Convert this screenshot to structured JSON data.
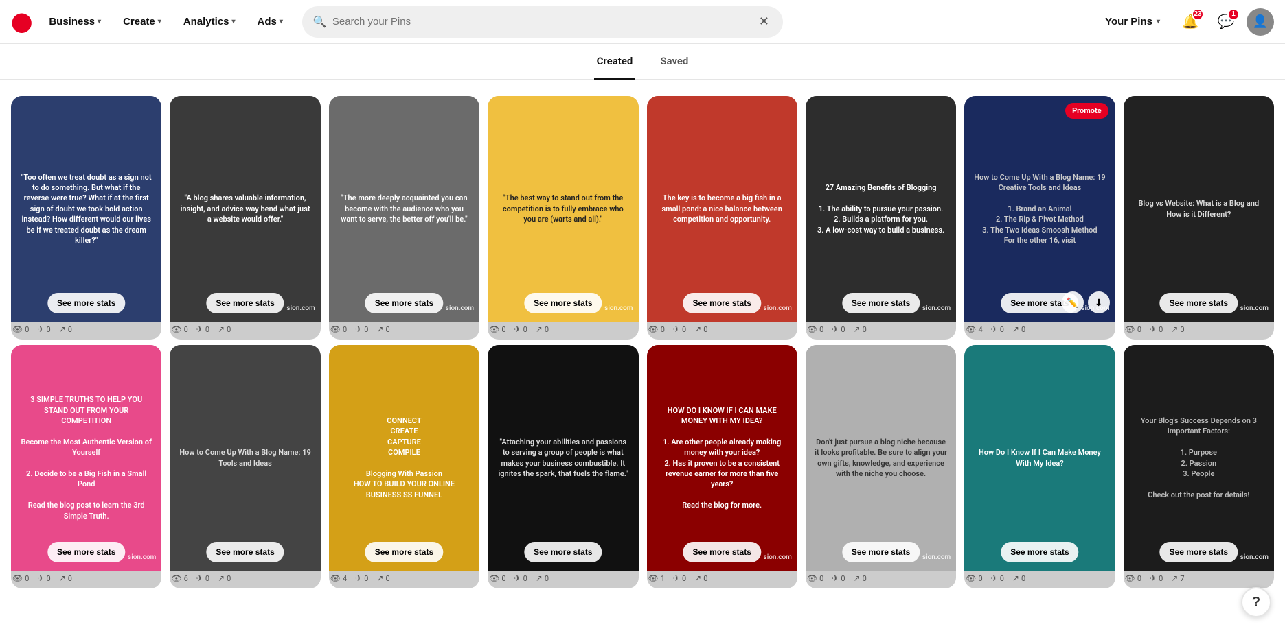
{
  "nav": {
    "logo": "●",
    "business_label": "Business",
    "create_label": "Create",
    "analytics_label": "Analytics",
    "ads_label": "Ads",
    "search_placeholder": "Search your Pins",
    "your_pins_label": "Your Pins",
    "notifications_badge": "23",
    "messages_badge": "1"
  },
  "tabs": {
    "created": "Created",
    "saved": "Saved"
  },
  "pins_row1": [
    {
      "id": "p1",
      "bg": "bg-dark-blue",
      "text": "\"Too often we treat doubt as a sign not to do something. But what if the reverse were true? What if at the first sign of doubt we took bold action instead? How different would our lives be if we treated doubt as the dream killer?\"",
      "stats": [
        0,
        0,
        0
      ],
      "see_more": "See more stats",
      "domain": ""
    },
    {
      "id": "p2",
      "bg": "bg-dark-gray",
      "text": "\"A blog shares valuable information, insight, and advice way bend what just a website would offer.\"",
      "stats": [
        0,
        0,
        0
      ],
      "see_more": "See more stats",
      "domain": "sion.com"
    },
    {
      "id": "p3",
      "bg": "bg-medium",
      "text": "\"The more deeply acquainted you can become with the audience who you want to serve, the better off you'll be.\"",
      "stats": [
        0,
        0,
        0
      ],
      "see_more": "See more stats",
      "domain": "sion.com"
    },
    {
      "id": "p4",
      "bg": "bg-yellow",
      "text": "\"The best way to stand out from the competition is to fully embrace who you are (warts and all).\"",
      "stats": [
        0,
        0,
        0
      ],
      "see_more": "See more stats",
      "domain": "sion.com"
    },
    {
      "id": "p5",
      "bg": "bg-red",
      "text": "The key is to become a big fish in a small pond: a nice balance between competition and opportunity.",
      "stats": [
        0,
        0,
        0
      ],
      "see_more": "See more stats",
      "domain": "sion.com"
    },
    {
      "id": "p6",
      "bg": "bg-dark-text",
      "text": "27 Amazing Benefits of Blogging\n\n1. The ability to pursue your passion.\n2. Builds a platform for you.\n3. A low-cost way to build a business.",
      "stats": [
        0,
        0,
        0
      ],
      "see_more": "See more stats",
      "domain": "sion.com"
    },
    {
      "id": "p7",
      "bg": "bg-dark-blue2",
      "text": "How to Come Up With a Blog Name: 19 Creative Tools and Ideas\n\n1. Brand an Animal\n2. The Rip & Pivot Method\n3. The Two Ideas Smoosh Method\nFor the other 16, visit",
      "stats": [
        4,
        0,
        0
      ],
      "see_more": "See more stats",
      "domain": "sion.com",
      "promote": true,
      "has_actions": true
    },
    {
      "id": "p8",
      "bg": "bg-dark",
      "text": "Blog vs Website: What is a Blog and How is it Different?",
      "stats": [
        0,
        0,
        0
      ],
      "see_more": "See more stats",
      "domain": "sion.com"
    }
  ],
  "pins_row2": [
    {
      "id": "p9",
      "bg": "bg-pink",
      "text": "3 SIMPLE TRUTHS TO HELP YOU STAND OUT FROM YOUR COMPETITION\n\nBecome the Most Authentic Version of Yourself\n\n2. Decide to be a Big Fish in a Small Pond\n\nRead the blog post to learn the 3rd Simple Truth.",
      "stats": [
        0,
        0,
        0
      ],
      "see_more": "See more stats",
      "domain": "sion.com"
    },
    {
      "id": "p10",
      "bg": "bg-charcoal",
      "text": "How to Come Up With a Blog Name: 19 Tools and Ideas",
      "stats": [
        6,
        0,
        0
      ],
      "see_more": "See more stats",
      "domain": ""
    },
    {
      "id": "p11",
      "bg": "bg-gold",
      "text": "CONNECT\nCREATE\nCAPTURE\nCOMPILE\n\nBlogging With Passion\nHOW TO BUILD YOUR ONLINE BUSINESS SS FUNNEL",
      "stats": [
        4,
        0,
        0
      ],
      "see_more": "See more stats",
      "domain": ""
    },
    {
      "id": "p12",
      "bg": "bg-black",
      "text": "\"Attaching your abilities and passions to serving a group of people is what makes your business combustible. It ignites the spark, that fuels the flame.\"",
      "stats": [
        0,
        0,
        0
      ],
      "see_more": "See more stats",
      "domain": ""
    },
    {
      "id": "p13",
      "bg": "bg-maroon",
      "text": "HOW DO I KNOW IF I CAN MAKE MONEY WITH MY IDEA?\n\n1. Are other people already making money with your idea?\n2. Has it proven to be a consistent revenue earner for more than five years?\n\nRead the blog for more.",
      "stats": [
        1,
        0,
        0
      ],
      "see_more": "See more stats",
      "domain": "sion.com"
    },
    {
      "id": "p14",
      "bg": "bg-gray-light",
      "text": "Don't just pursue a blog niche because it looks profitable. Be sure to align your own gifts, knowledge, and experience with the niche you choose.",
      "stats": [
        0,
        0,
        0
      ],
      "see_more": "See more stats",
      "domain": "sion.com"
    },
    {
      "id": "p15",
      "bg": "bg-teal",
      "text": "How Do I Know If I Can Make Money With My Idea?",
      "stats": [
        0,
        0,
        0
      ],
      "see_more": "See more stats",
      "domain": ""
    },
    {
      "id": "p16",
      "bg": "bg-dark3",
      "text": "Your Blog's Success Depends on 3 Important Factors:\n\n1. Purpose\n2. Passion\n3. People\n\nCheck out the post for details!",
      "stats": [
        0,
        0,
        7
      ],
      "see_more": "See more stats",
      "domain": "sion.com"
    }
  ],
  "help": "?"
}
